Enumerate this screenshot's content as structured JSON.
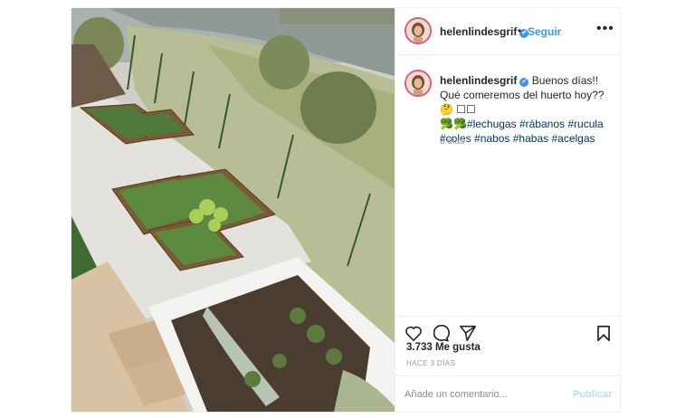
{
  "post": {
    "username": "helenlindesgrif",
    "verified_mark": "✔",
    "follow_separator": "•",
    "follow_label": "Seguir",
    "more_label": "•••",
    "caption": {
      "text_line": "Buenos días!! Qué comeremos del huerto hoy?? 🤔 ☐☐",
      "emoji_line": "🥦🥦",
      "hashtags": [
        "#lechugas",
        "#rábanos",
        "#rucula",
        "#coles",
        "#nabos",
        "#habas",
        "#acelgas"
      ]
    },
    "time_ago": "3 días",
    "likes": "3.733 Me gusta",
    "posted_ago": "HACE 3 DÍAS",
    "comment_placeholder": "Añade un comentario...",
    "publish_label": "Publicar",
    "icons": {
      "like": "heart-icon",
      "comment": "comment-icon",
      "share": "share-icon",
      "save": "bookmark-icon",
      "more": "more-options-icon",
      "verified": "verified-badge-icon"
    },
    "colors": {
      "accent": "#3897f0",
      "avatar_ring": "#e8567a",
      "hashtag": "#003569",
      "muted": "#999999",
      "publish_disabled": "#b2dffc"
    }
  }
}
